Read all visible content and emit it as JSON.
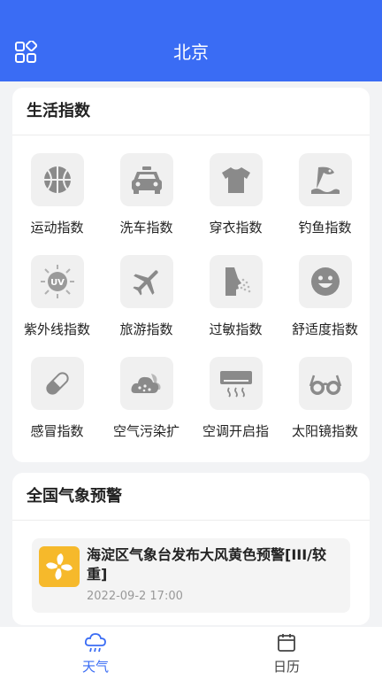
{
  "header": {
    "title": "北京"
  },
  "life_index": {
    "title": "生活指数",
    "items": [
      {
        "label": "运动指数",
        "icon": "basketball-icon"
      },
      {
        "label": "洗车指数",
        "icon": "car-icon"
      },
      {
        "label": "穿衣指数",
        "icon": "tshirt-icon"
      },
      {
        "label": "钓鱼指数",
        "icon": "fishing-icon"
      },
      {
        "label": "紫外线指数",
        "icon": "uv-sun-icon"
      },
      {
        "label": "旅游指数",
        "icon": "airplane-icon"
      },
      {
        "label": "过敏指数",
        "icon": "allergy-icon"
      },
      {
        "label": "舒适度指数",
        "icon": "smiley-icon"
      },
      {
        "label": "感冒指数",
        "icon": "pill-icon"
      },
      {
        "label": "空气污染扩",
        "icon": "pollution-cloud-icon"
      },
      {
        "label": "空调开启指",
        "icon": "air-conditioner-icon"
      },
      {
        "label": "太阳镜指数",
        "icon": "sunglasses-icon"
      }
    ],
    "uv_text": "UV"
  },
  "warnings": {
    "title": "全国气象预警",
    "items": [
      {
        "text": "海淀区气象台发布大风黄色预警[III/较重]",
        "time": "2022-09-2 17:00",
        "icon": "wind-fan-icon",
        "color": "#f6b92b"
      }
    ]
  },
  "tabs": [
    {
      "label": "天气",
      "icon": "rain-cloud-icon",
      "active": true
    },
    {
      "label": "日历",
      "icon": "calendar-icon",
      "active": false
    }
  ],
  "colors": {
    "accent": "#3a6cf4",
    "icon_gray": "#8a8a8a",
    "warning_yellow": "#f6b92b"
  }
}
